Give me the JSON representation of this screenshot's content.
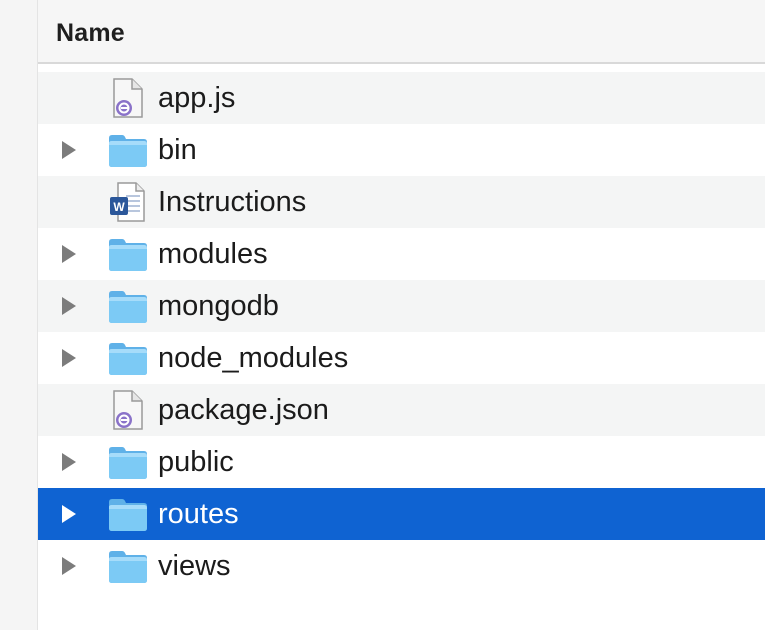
{
  "header": {
    "name_label": "Name"
  },
  "files": [
    {
      "name": "app.js",
      "kind": "script",
      "icon": "js-document-icon",
      "expandable": false,
      "selected": false
    },
    {
      "name": "bin",
      "kind": "folder",
      "icon": "folder-icon",
      "expandable": true,
      "selected": false
    },
    {
      "name": "Instructions",
      "kind": "word",
      "icon": "word-document-icon",
      "expandable": false,
      "selected": false
    },
    {
      "name": "modules",
      "kind": "folder",
      "icon": "folder-icon",
      "expandable": true,
      "selected": false
    },
    {
      "name": "mongodb",
      "kind": "folder",
      "icon": "folder-icon",
      "expandable": true,
      "selected": false
    },
    {
      "name": "node_modules",
      "kind": "folder",
      "icon": "folder-icon",
      "expandable": true,
      "selected": false
    },
    {
      "name": "package.json",
      "kind": "script",
      "icon": "js-document-icon",
      "expandable": false,
      "selected": false
    },
    {
      "name": "public",
      "kind": "folder",
      "icon": "folder-icon",
      "expandable": true,
      "selected": false
    },
    {
      "name": "routes",
      "kind": "folder",
      "icon": "folder-icon",
      "expandable": true,
      "selected": true
    },
    {
      "name": "views",
      "kind": "folder",
      "icon": "folder-icon",
      "expandable": true,
      "selected": false
    }
  ],
  "colors": {
    "selection": "#0f63d2",
    "folder": "#6fc0f2",
    "disclosure": "#7c7c7c",
    "row_alt": "#f4f5f5",
    "word_blue": "#2b579a"
  }
}
